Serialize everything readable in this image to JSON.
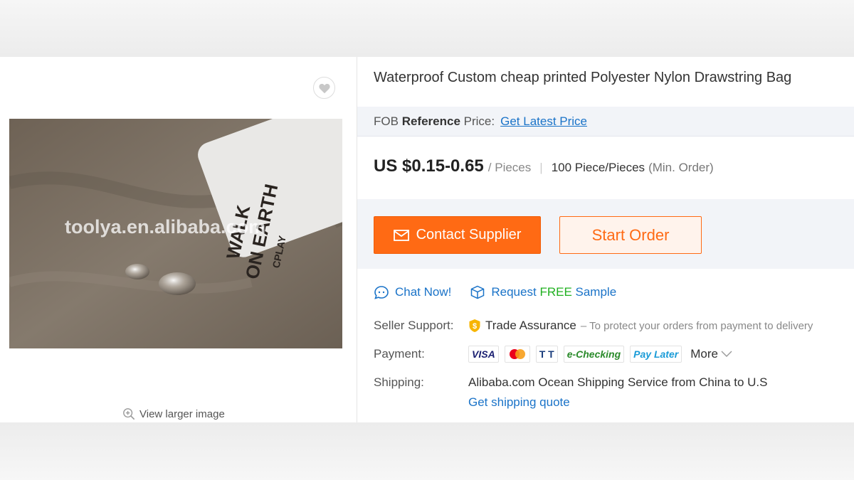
{
  "product": {
    "title": "Waterproof Custom cheap printed Polyester Nylon Drawstring Bag",
    "image": {
      "watermark": "toolya.en.alibaba.com",
      "label_line1": "WALK",
      "label_line2": "ON EARTH",
      "label_line3": "CPLAY"
    },
    "view_larger": "View larger image",
    "favorite_icon": "heart-icon"
  },
  "pricing": {
    "fob_prefix": "FOB",
    "fob_bold": "Reference",
    "fob_suffix": "Price:",
    "get_latest": "Get Latest Price",
    "price": "US $0.15-0.65",
    "unit": "/ Pieces",
    "separator": "|",
    "min_order": "100 Piece/Pieces",
    "min_order_note": "(Min. Order)"
  },
  "actions": {
    "contact_supplier": "Contact Supplier",
    "start_order": "Start Order",
    "chat_now": "Chat Now!",
    "request_prefix": "Request",
    "request_free": "FREE",
    "request_suffix": "Sample"
  },
  "details": {
    "seller_support_label": "Seller Support:",
    "trade_assurance": "Trade Assurance",
    "trade_assurance_note": "– To protect your orders from payment to delivery",
    "payment_label": "Payment:",
    "payment_methods": {
      "visa": "VISA",
      "tt": "T T",
      "echecking": "e-Checking",
      "paylater": "Pay Later"
    },
    "more": "More",
    "shipping_label": "Shipping:",
    "shipping_value": "Alibaba.com Ocean Shipping Service from China to U.S",
    "shipping_quote": "Get shipping quote"
  },
  "colors": {
    "accent": "#ff6a14",
    "link": "#1a73c8",
    "free": "#20b020"
  }
}
